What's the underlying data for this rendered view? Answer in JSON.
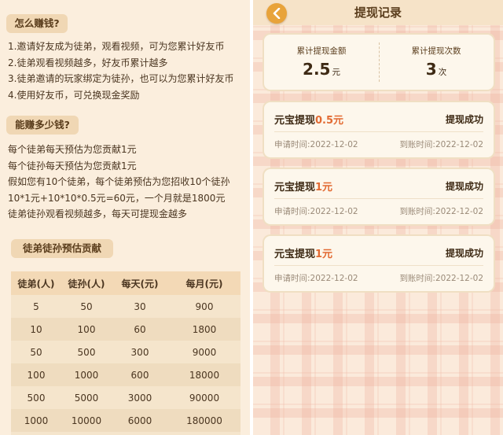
{
  "left": {
    "how_title": "怎么赚钱?",
    "how_lines": [
      "1.邀请好友成为徒弟，观看视频，可为您累计好友币",
      "2.徒弟观看视频越多，好友币累计越多",
      "3.徒弟邀请的玩家绑定为徒孙，也可以为您累计好友币",
      "4.使用好友币，可兑换现金奖励"
    ],
    "much_title": "能赚多少钱?",
    "much_lines": [
      "每个徒弟每天预估为您贡献1元",
      "每个徒孙每天预估为您贡献1元",
      "假如您有10个徒弟，每个徒弟预估为您招收10个徒孙",
      "10*1元+10*10*0.5元=60元，一个月就是1800元",
      "徒弟徒孙观看视频越多，每天可提现金越多"
    ],
    "table_title": "徒弟徒孙预估贡献",
    "table": {
      "headers": [
        "徒弟(人)",
        "徒孙(人)",
        "每天(元)",
        "每月(元)"
      ],
      "rows": [
        [
          "5",
          "50",
          "30",
          "900"
        ],
        [
          "10",
          "100",
          "60",
          "1800"
        ],
        [
          "50",
          "500",
          "300",
          "9000"
        ],
        [
          "100",
          "1000",
          "600",
          "18000"
        ],
        [
          "500",
          "5000",
          "3000",
          "90000"
        ],
        [
          "1000",
          "10000",
          "6000",
          "180000"
        ]
      ]
    }
  },
  "right": {
    "title": "提现记录",
    "back_icon": "chevron-left-icon",
    "summary": {
      "amount_label": "累计提现金额",
      "amount_value": "2.5",
      "amount_unit": "元",
      "count_label": "累计提现次数",
      "count_value": "3",
      "count_unit": "次"
    },
    "records": [
      {
        "title": "元宝提现",
        "amount": "0.5元",
        "status": "提现成功",
        "apply_time": "申请时间:2022-12-02",
        "arrive_time": "到账时间:2022-12-02"
      },
      {
        "title": "元宝提现",
        "amount": "1元",
        "status": "提现成功",
        "apply_time": "申请时间:2022-12-02",
        "arrive_time": "到账时间:2022-12-02"
      },
      {
        "title": "元宝提现",
        "amount": "1元",
        "status": "提现成功",
        "apply_time": "申请时间:2022-12-02",
        "arrive_time": "到账时间:2022-12-02"
      }
    ]
  },
  "colors": {
    "left_bg": "#fbeedd",
    "pill_bg": "#f0d7b4",
    "accent_orange": "#e8a33a",
    "amount_red": "#e26a32",
    "card_bg": "#fdf7ec"
  }
}
